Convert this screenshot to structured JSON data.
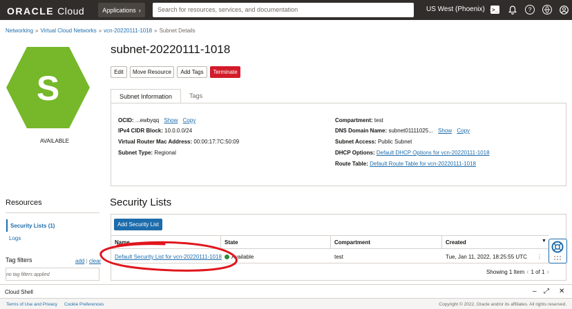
{
  "topbar": {
    "brand": "ORACLE",
    "product": "Cloud",
    "apps_label": "Applications",
    "search_placeholder": "Search for resources, services, and documentation",
    "region": "US West (Phoenix)"
  },
  "breadcrumb": {
    "items": [
      "Networking",
      "Virtual Cloud Networks",
      "vcn-20220111-1018",
      "Subnet Details"
    ]
  },
  "resource": {
    "icon_letter": "S",
    "status": "AVAILABLE",
    "status_color": "#76b82a",
    "name": "subnet-20220111-1018"
  },
  "actions": {
    "edit": "Edit",
    "move": "Move Resource",
    "add_tags": "Add Tags",
    "terminate": "Terminate"
  },
  "tabs": [
    "Subnet Information",
    "Tags"
  ],
  "info": {
    "ocid_label": "OCID:",
    "ocid_value": "...ewbyqq",
    "show": "Show",
    "copy": "Copy",
    "cidr_label": "IPv4 CIDR Block:",
    "cidr_value": "10.0.0.0/24",
    "mac_label": "Virtual Router Mac Address:",
    "mac_value": "00:00:17:7C:50:09",
    "type_label": "Subnet Type:",
    "type_value": "Regional",
    "compartment_label": "Compartment:",
    "compartment_value": "test",
    "dns_label": "DNS Domain Name:",
    "dns_value": "subnet01111025...",
    "access_label": "Subnet Access:",
    "access_value": "Public Subnet",
    "dhcp_label": "DHCP Options:",
    "dhcp_value": "Default DHCP Options for vcn-20220111-1018",
    "route_label": "Route Table:",
    "route_value": "Default Route Table for vcn-20220111-1018"
  },
  "sidebar": {
    "resources_title": "Resources",
    "items": [
      "Security Lists (1)",
      "Logs"
    ],
    "tag_filters": "Tag filters",
    "add": "add",
    "sep": "|",
    "clear": "clear",
    "no_tags": "no tag filters applied"
  },
  "security_lists": {
    "title": "Security Lists",
    "add_button": "Add Security List",
    "columns": [
      "Name",
      "State",
      "Compartment",
      "Created"
    ],
    "rows": [
      {
        "name": "Default Security List for vcn-20220111-1018",
        "state": "Available",
        "compartment": "test",
        "created": "Tue, Jan 11, 2022, 18:25:55 UTC"
      }
    ],
    "showing": "Showing 1 Item",
    "page": "1 of 1"
  },
  "cloud_shell": {
    "label": "Cloud Shell"
  },
  "footer": {
    "terms": "Terms of Use and Privacy",
    "cookies": "Cookie Preferences",
    "copyright": "Copyright © 2022, Oracle and/or its affiliates. All rights reserved."
  }
}
